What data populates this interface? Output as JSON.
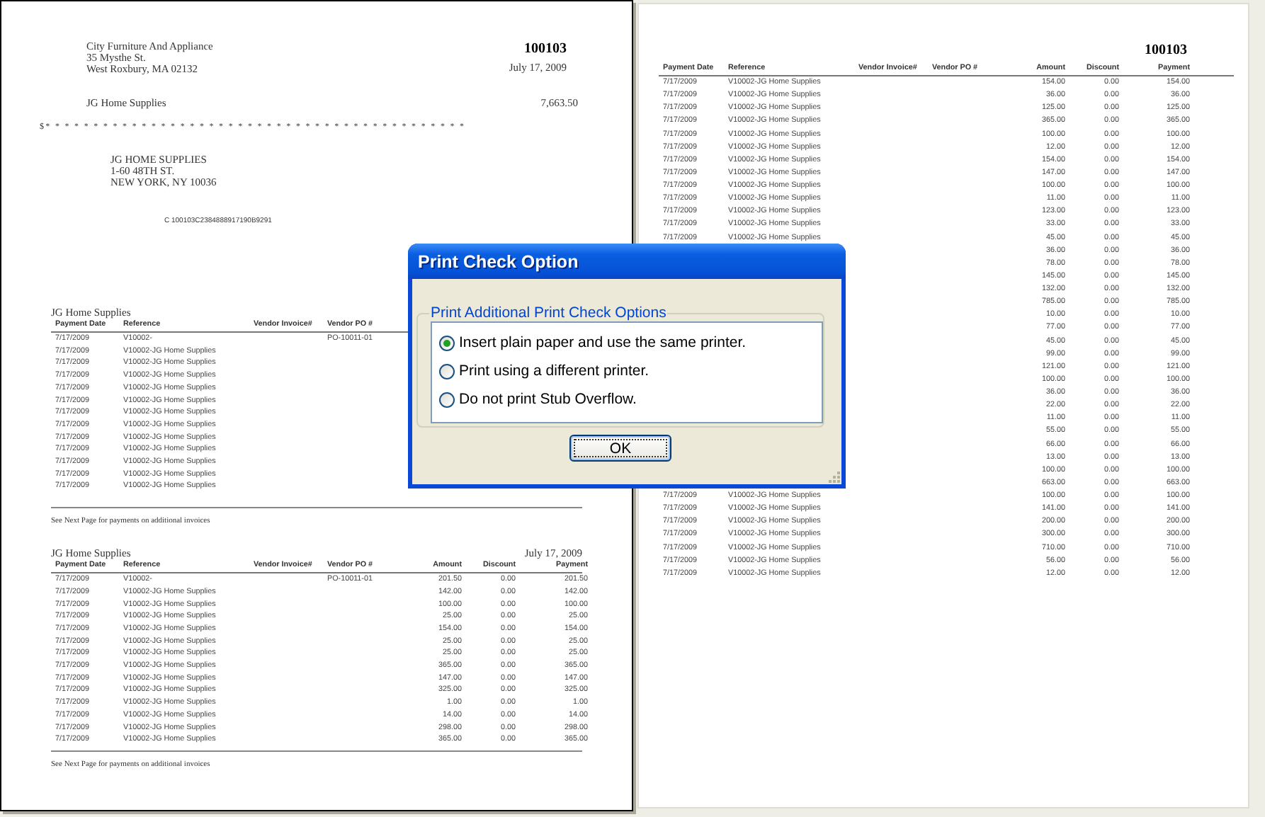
{
  "check_page": {
    "payer_lines": [
      "City Furniture And Appliance",
      "35 Mysthe St.",
      "West Roxbury, MA 02132"
    ],
    "check_number": "100103",
    "date": "July 17, 2009",
    "payee": "JG Home Supplies",
    "amount": "7,663.50",
    "amount_line": "$* * * * * * * * * * * * * * * * * * * * * * * * * * * * * * * * * * * * * * * * * * * *",
    "address_lines": [
      "JG HOME SUPPLIES",
      "1-60 48TH ST.",
      "NEW YORK, NY 10036"
    ],
    "micr_line": "C 100103C2384888917190B9291",
    "stubs": [
      {
        "title": "JG Home Supplies",
        "columns": [
          "Payment Date",
          "Reference",
          "Vendor Invoice#",
          "Vendor PO #"
        ],
        "rows": [
          {
            "date": "7/17/2009",
            "reference": "V10002-",
            "vendor_po": "PO-10011-01"
          },
          {
            "date": "7/17/2009",
            "reference": "V10002-JG Home Supplies"
          },
          {
            "date": "7/17/2009",
            "reference": "V10002-JG Home Supplies"
          },
          {
            "date": "7/17/2009",
            "reference": "V10002-JG Home Supplies"
          },
          {
            "date": "7/17/2009",
            "reference": "V10002-JG Home Supplies"
          },
          {
            "date": "7/17/2009",
            "reference": "V10002-JG Home Supplies"
          },
          {
            "date": "7/17/2009",
            "reference": "V10002-JG Home Supplies"
          },
          {
            "date": "7/17/2009",
            "reference": "V10002-JG Home Supplies"
          },
          {
            "date": "7/17/2009",
            "reference": "V10002-JG Home Supplies"
          },
          {
            "date": "7/17/2009",
            "reference": "V10002-JG Home Supplies"
          },
          {
            "date": "7/17/2009",
            "reference": "V10002-JG Home Supplies"
          },
          {
            "date": "7/17/2009",
            "reference": "V10002-JG Home Supplies"
          },
          {
            "date": "7/17/2009",
            "reference": "V10002-JG Home Supplies"
          }
        ],
        "note": "See Next Page for payments on additional invoices"
      },
      {
        "title": "JG Home Supplies",
        "date": "July 17, 2009",
        "columns": [
          "Payment Date",
          "Reference",
          "Vendor Invoice#",
          "Vendor PO #",
          "Amount",
          "Discount",
          "Payment"
        ],
        "rows": [
          {
            "date": "7/17/2009",
            "reference": "V10002-",
            "vendor_po": "PO-10011-01",
            "amount": "201.50",
            "discount": "0.00",
            "payment": "201.50"
          },
          {
            "date": "7/17/2009",
            "reference": "V10002-JG Home Supplies",
            "amount": "142.00",
            "discount": "0.00",
            "payment": "142.00"
          },
          {
            "date": "7/17/2009",
            "reference": "V10002-JG Home Supplies",
            "amount": "100.00",
            "discount": "0.00",
            "payment": "100.00"
          },
          {
            "date": "7/17/2009",
            "reference": "V10002-JG Home Supplies",
            "amount": "25.00",
            "discount": "0.00",
            "payment": "25.00"
          },
          {
            "date": "7/17/2009",
            "reference": "V10002-JG Home Supplies",
            "amount": "154.00",
            "discount": "0.00",
            "payment": "154.00"
          },
          {
            "date": "7/17/2009",
            "reference": "V10002-JG Home Supplies",
            "amount": "25.00",
            "discount": "0.00",
            "payment": "25.00"
          },
          {
            "date": "7/17/2009",
            "reference": "V10002-JG Home Supplies",
            "amount": "25.00",
            "discount": "0.00",
            "payment": "25.00"
          },
          {
            "date": "7/17/2009",
            "reference": "V10002-JG Home Supplies",
            "amount": "365.00",
            "discount": "0.00",
            "payment": "365.00"
          },
          {
            "date": "7/17/2009",
            "reference": "V10002-JG Home Supplies",
            "amount": "147.00",
            "discount": "0.00",
            "payment": "147.00"
          },
          {
            "date": "7/17/2009",
            "reference": "V10002-JG Home Supplies",
            "amount": "325.00",
            "discount": "0.00",
            "payment": "325.00"
          },
          {
            "date": "7/17/2009",
            "reference": "V10002-JG Home Supplies",
            "amount": "1.00",
            "discount": "0.00",
            "payment": "1.00"
          },
          {
            "date": "7/17/2009",
            "reference": "V10002-JG Home Supplies",
            "amount": "14.00",
            "discount": "0.00",
            "payment": "14.00"
          },
          {
            "date": "7/17/2009",
            "reference": "V10002-JG Home Supplies",
            "amount": "298.00",
            "discount": "0.00",
            "payment": "298.00"
          },
          {
            "date": "7/17/2009",
            "reference": "V10002-JG Home Supplies",
            "amount": "365.00",
            "discount": "0.00",
            "payment": "365.00"
          }
        ],
        "note": "See Next Page for payments on additional invoices"
      }
    ]
  },
  "detail_page": {
    "check_number": "100103",
    "columns": [
      "Payment Date",
      "Reference",
      "Vendor Invoice#",
      "Vendor PO #",
      "Amount",
      "Discount",
      "Payment"
    ],
    "rows": [
      {
        "date": "7/17/2009",
        "reference": "V10002-JG Home Supplies",
        "amount": "154.00",
        "discount": "0.00",
        "payment": "154.00"
      },
      {
        "date": "7/17/2009",
        "reference": "V10002-JG Home Supplies",
        "amount": "36.00",
        "discount": "0.00",
        "payment": "36.00"
      },
      {
        "date": "7/17/2009",
        "reference": "V10002-JG Home Supplies",
        "amount": "125.00",
        "discount": "0.00",
        "payment": "125.00"
      },
      {
        "date": "7/17/2009",
        "reference": "V10002-JG Home Supplies",
        "amount": "365.00",
        "discount": "0.00",
        "payment": "365.00"
      },
      {
        "date": "7/17/2009",
        "reference": "V10002-JG Home Supplies",
        "amount": "100.00",
        "discount": "0.00",
        "payment": "100.00"
      },
      {
        "date": "7/17/2009",
        "reference": "V10002-JG Home Supplies",
        "amount": "12.00",
        "discount": "0.00",
        "payment": "12.00"
      },
      {
        "date": "7/17/2009",
        "reference": "V10002-JG Home Supplies",
        "amount": "154.00",
        "discount": "0.00",
        "payment": "154.00"
      },
      {
        "date": "7/17/2009",
        "reference": "V10002-JG Home Supplies",
        "amount": "147.00",
        "discount": "0.00",
        "payment": "147.00"
      },
      {
        "date": "7/17/2009",
        "reference": "V10002-JG Home Supplies",
        "amount": "100.00",
        "discount": "0.00",
        "payment": "100.00"
      },
      {
        "date": "7/17/2009",
        "reference": "V10002-JG Home Supplies",
        "amount": "11.00",
        "discount": "0.00",
        "payment": "11.00"
      },
      {
        "date": "7/17/2009",
        "reference": "V10002-JG Home Supplies",
        "amount": "123.00",
        "discount": "0.00",
        "payment": "123.00"
      },
      {
        "date": "7/17/2009",
        "reference": "V10002-JG Home Supplies",
        "amount": "33.00",
        "discount": "0.00",
        "payment": "33.00"
      },
      {
        "date": "7/17/2009",
        "reference": "V10002-JG Home Supplies",
        "amount": "45.00",
        "discount": "0.00",
        "payment": "45.00"
      },
      {
        "amount": "36.00",
        "discount": "0.00",
        "payment": "36.00"
      },
      {
        "amount": "78.00",
        "discount": "0.00",
        "payment": "78.00"
      },
      {
        "amount": "145.00",
        "discount": "0.00",
        "payment": "145.00"
      },
      {
        "amount": "132.00",
        "discount": "0.00",
        "payment": "132.00"
      },
      {
        "amount": "785.00",
        "discount": "0.00",
        "payment": "785.00"
      },
      {
        "amount": "10.00",
        "discount": "0.00",
        "payment": "10.00"
      },
      {
        "amount": "77.00",
        "discount": "0.00",
        "payment": "77.00"
      },
      {
        "amount": "45.00",
        "discount": "0.00",
        "payment": "45.00"
      },
      {
        "amount": "99.00",
        "discount": "0.00",
        "payment": "99.00"
      },
      {
        "amount": "121.00",
        "discount": "0.00",
        "payment": "121.00"
      },
      {
        "amount": "100.00",
        "discount": "0.00",
        "payment": "100.00"
      },
      {
        "amount": "36.00",
        "discount": "0.00",
        "payment": "36.00"
      },
      {
        "amount": "22.00",
        "discount": "0.00",
        "payment": "22.00"
      },
      {
        "amount": "11.00",
        "discount": "0.00",
        "payment": "11.00"
      },
      {
        "amount": "55.00",
        "discount": "0.00",
        "payment": "55.00"
      },
      {
        "amount": "66.00",
        "discount": "0.00",
        "payment": "66.00"
      },
      {
        "amount": "13.00",
        "discount": "0.00",
        "payment": "13.00"
      },
      {
        "amount": "100.00",
        "discount": "0.00",
        "payment": "100.00"
      },
      {
        "amount": "663.00",
        "discount": "0.00",
        "payment": "663.00"
      },
      {
        "date": "7/17/2009",
        "reference": "V10002-JG Home Supplies",
        "amount": "100.00",
        "discount": "0.00",
        "payment": "100.00"
      },
      {
        "date": "7/17/2009",
        "reference": "V10002-JG Home Supplies",
        "amount": "141.00",
        "discount": "0.00",
        "payment": "141.00"
      },
      {
        "date": "7/17/2009",
        "reference": "V10002-JG Home Supplies",
        "amount": "200.00",
        "discount": "0.00",
        "payment": "200.00"
      },
      {
        "date": "7/17/2009",
        "reference": "V10002-JG Home Supplies",
        "amount": "300.00",
        "discount": "0.00",
        "payment": "300.00"
      },
      {
        "date": "7/17/2009",
        "reference": "V10002-JG Home Supplies",
        "amount": "710.00",
        "discount": "0.00",
        "payment": "710.00"
      },
      {
        "date": "7/17/2009",
        "reference": "V10002-JG Home Supplies",
        "amount": "56.00",
        "discount": "0.00",
        "payment": "56.00"
      },
      {
        "date": "7/17/2009",
        "reference": "V10002-JG Home Supplies",
        "amount": "12.00",
        "discount": "0.00",
        "payment": "12.00"
      }
    ]
  },
  "dialog": {
    "title": "Print Check Option",
    "group_label": "Print Additional Print Check Options",
    "options": [
      {
        "label": "Insert plain paper and use the same printer.",
        "selected": true
      },
      {
        "label": "Print using a different printer.",
        "selected": false
      },
      {
        "label": "Do not print Stub Overflow.",
        "selected": false
      }
    ],
    "buttons": [
      "OK"
    ]
  }
}
